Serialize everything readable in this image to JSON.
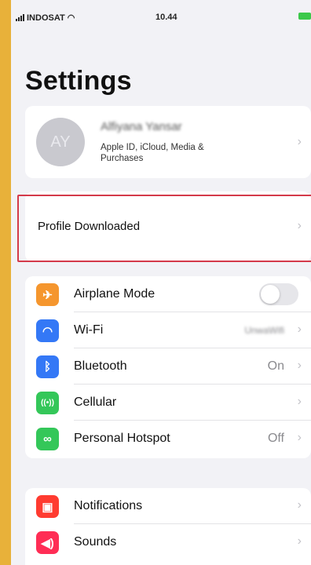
{
  "status_bar": {
    "carrier": "INDOSAT",
    "time": "10.44"
  },
  "title": "Settings",
  "profile": {
    "name": "Alfiyana Yansar",
    "initials": "AY",
    "subtitle": "Apple ID, iCloud, Media & Purchases"
  },
  "profile_downloaded": {
    "label": "Profile Downloaded"
  },
  "connectivity": [
    {
      "label": "Airplane Mode",
      "color": "#f5962e",
      "icon": "airplane-icon",
      "value": ""
    },
    {
      "label": "Wi-Fi",
      "color": "#3478f6",
      "icon": "wifi-icon",
      "value": "UnwaWifi"
    },
    {
      "label": "Bluetooth",
      "color": "#3478f6",
      "icon": "bluetooth-icon",
      "value": "On"
    },
    {
      "label": "Cellular",
      "color": "#34c759",
      "icon": "cellular-icon",
      "value": ""
    },
    {
      "label": "Personal Hotspot",
      "color": "#34c759",
      "icon": "hotspot-icon",
      "value": "Off"
    }
  ],
  "airplane_mode_on": false,
  "notifications_group": [
    {
      "label": "Notifications",
      "color": "#ff3b30",
      "icon": "notifications-icon"
    },
    {
      "label": "Sounds",
      "color": "#ff2d55",
      "icon": "sounds-icon"
    }
  ]
}
